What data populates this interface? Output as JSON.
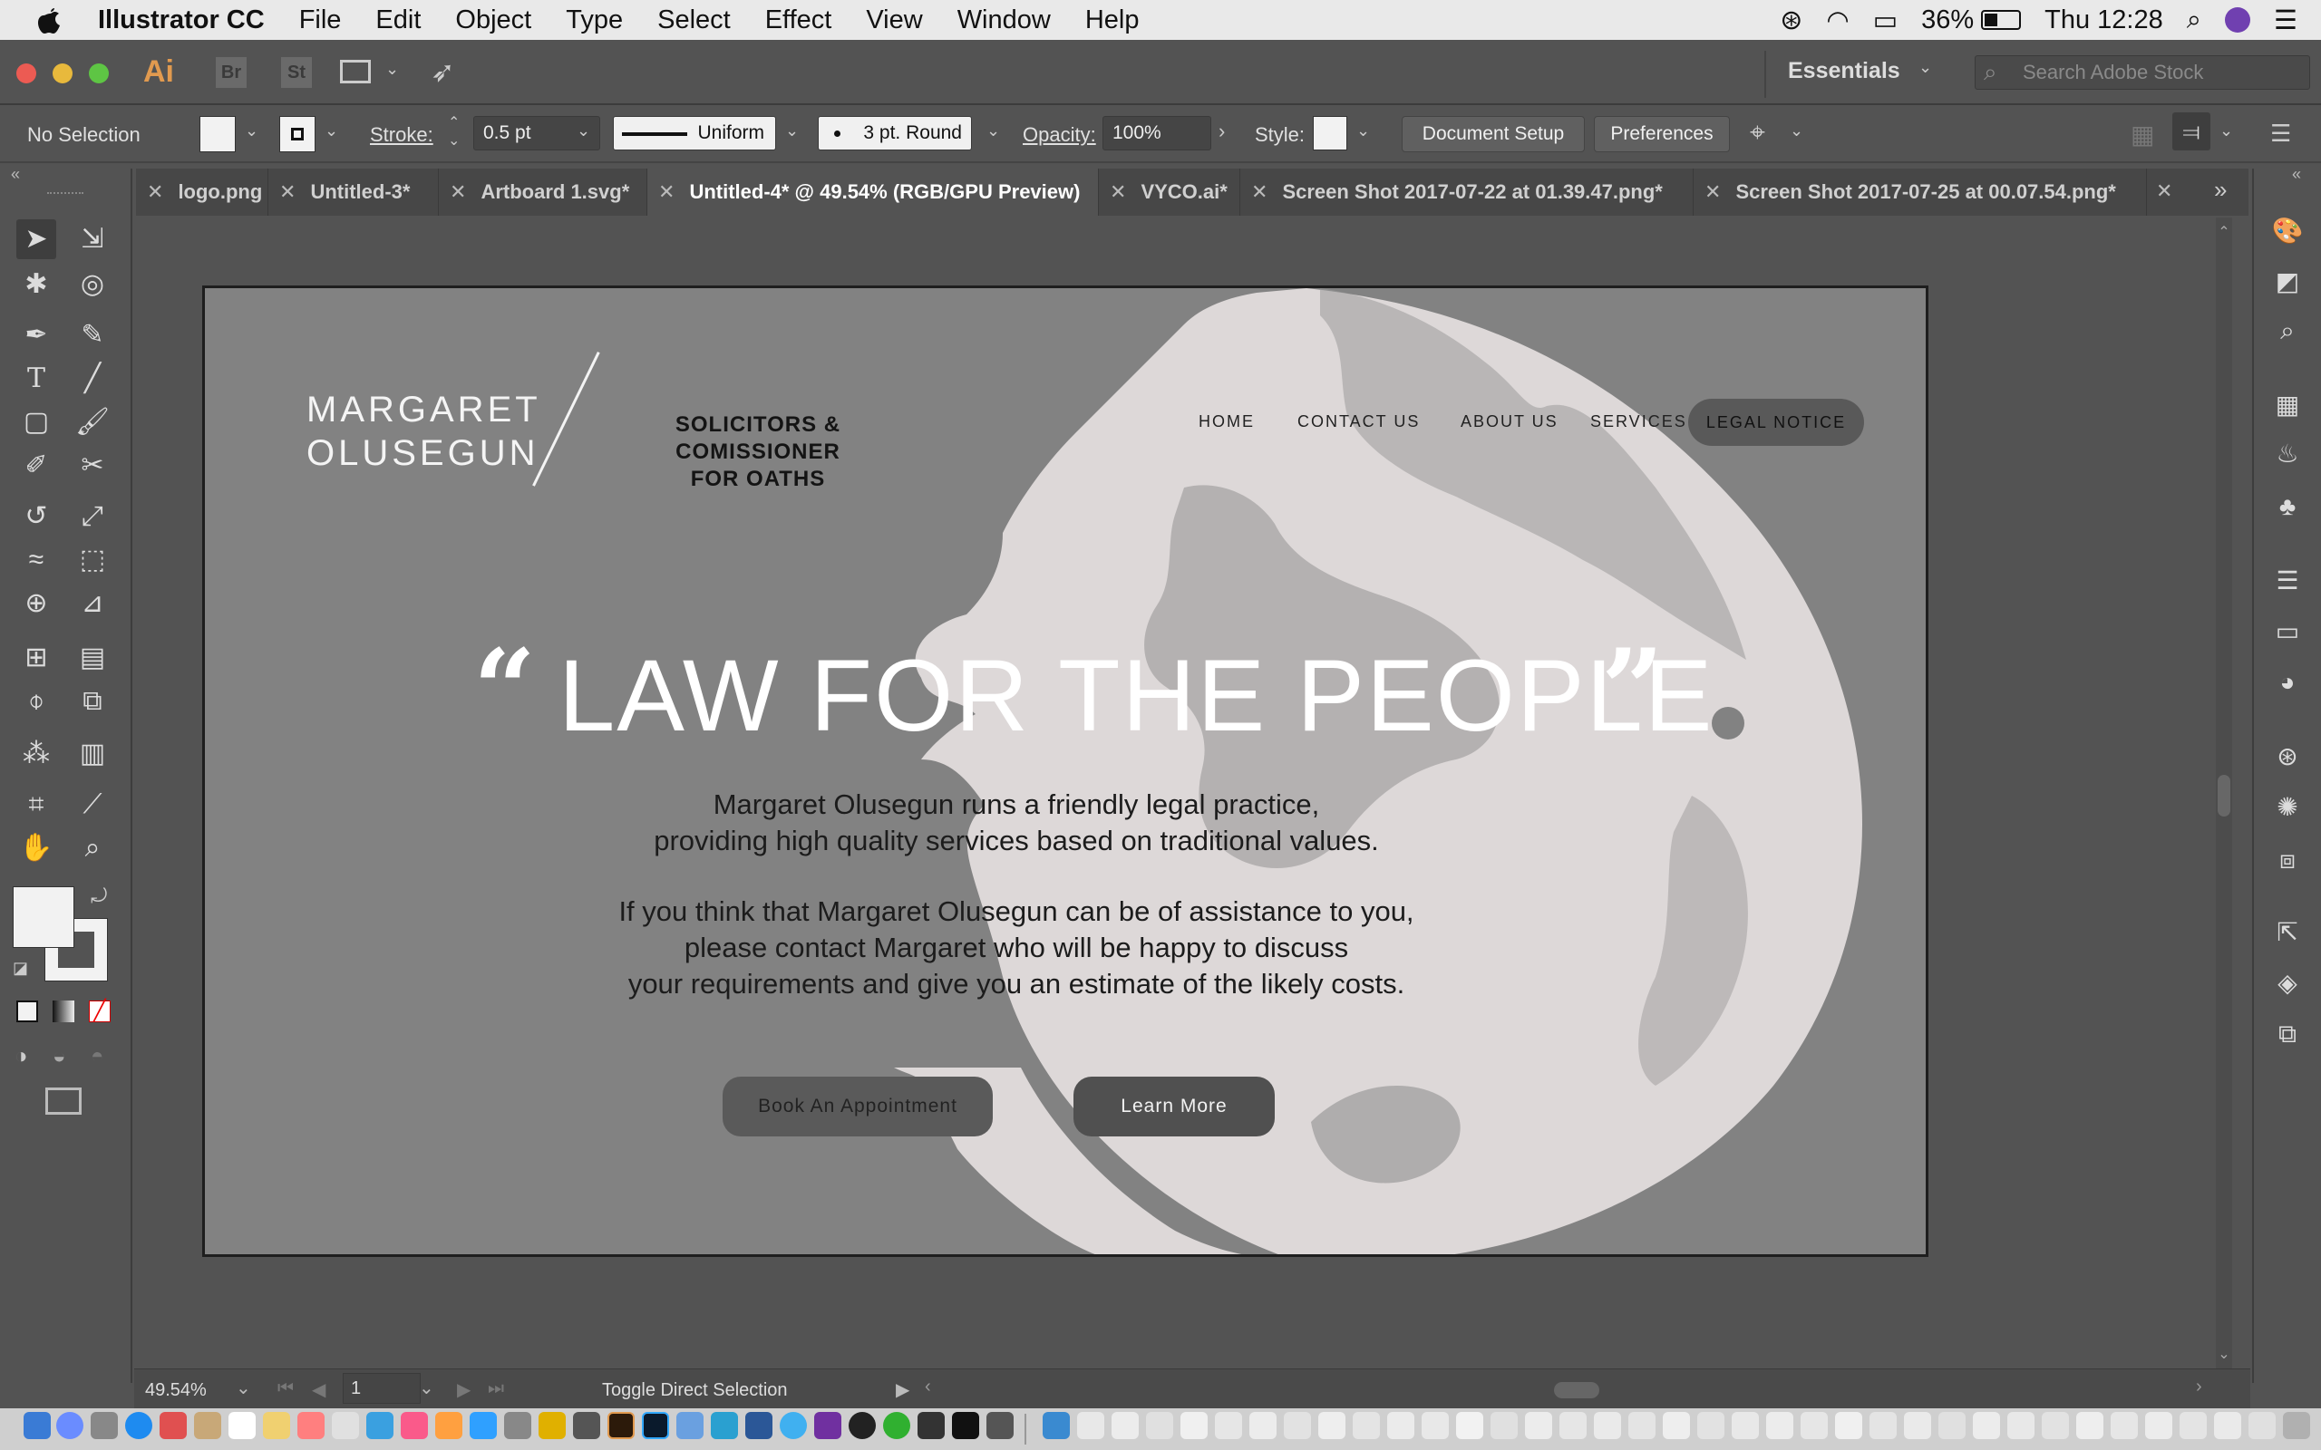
{
  "menubar": {
    "app_name": "Illustrator CC",
    "items": [
      "File",
      "Edit",
      "Object",
      "Type",
      "Select",
      "Effect",
      "View",
      "Window",
      "Help"
    ],
    "battery": "36%",
    "clock": "Thu 12:28"
  },
  "appbar": {
    "ai_logo": "Ai",
    "br": "Br",
    "st": "St",
    "workspace": "Essentials",
    "stock_search_placeholder": "Search Adobe Stock"
  },
  "control": {
    "selection": "No Selection",
    "stroke_label": "Stroke:",
    "stroke_value": "0.5 pt",
    "profile": "Uniform",
    "brush": "3 pt. Round",
    "opacity_label": "Opacity:",
    "opacity_value": "100%",
    "style_label": "Style:",
    "document_setup": "Document Setup",
    "preferences": "Preferences"
  },
  "tabs": [
    {
      "label": "logo.png"
    },
    {
      "label": "Untitled-3*"
    },
    {
      "label": "Artboard 1.svg*"
    },
    {
      "label": "Untitled-4* @ 49.54% (RGB/GPU Preview)"
    },
    {
      "label": "VYCO.ai*"
    },
    {
      "label": "Screen Shot 2017-07-22 at 01.39.47.png*"
    },
    {
      "label": "Screen Shot 2017-07-25 at 00.07.54.png*"
    }
  ],
  "artboard": {
    "brand_line1": "MARGARET",
    "brand_line2": "OLUSEGUN",
    "tagline_line1": "SOLICITORS & COMISSIONER",
    "tagline_line2": "FOR OATHS",
    "nav": [
      "HOME",
      "CONTACT US",
      "ABOUT US",
      "SERVICES"
    ],
    "legal_notice": "LEGAL NOTICE",
    "open_quote": "“",
    "close_quote": "”",
    "headline": "LAW FOR THE PEOPLE",
    "para1_line1": "Margaret Olusegun runs a friendly legal practice,",
    "para1_line2": "providing high quality services based on traditional values.",
    "para2_line1": "If you think that Margaret Olusegun can be of assistance to you,",
    "para2_line2": "please contact Margaret who will be happy to discuss",
    "para2_line3": "your requirements and give you an estimate of the likely costs.",
    "book_button": "Book An Appointment",
    "learn_button": "Learn More"
  },
  "status": {
    "zoom": "49.54%",
    "artboard_number": "1",
    "current_tool": "Toggle Direct Selection"
  },
  "colors": {
    "menubar_bg": "#e9e9e9",
    "ui_bg": "#535353",
    "artboard_bg": "#828282",
    "globe": "#ddd8d8",
    "ai_orange": "#e19a4f"
  }
}
